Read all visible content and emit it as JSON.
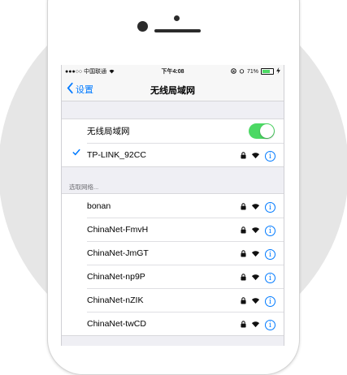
{
  "status_bar": {
    "carrier": "●●●○○ 中国联通",
    "time": "下午4:08",
    "battery": "71%",
    "battery_level": 0.71
  },
  "nav": {
    "back_label": "设置",
    "title": "无线局域网"
  },
  "wifi_toggle": {
    "label": "无线局域网",
    "on": true
  },
  "connected_network": {
    "name": "TP-LINK_92CC"
  },
  "section_header": "选取网络...",
  "networks": [
    {
      "name": "bonan"
    },
    {
      "name": "ChinaNet-FmvH"
    },
    {
      "name": "ChinaNet-JmGT"
    },
    {
      "name": "ChinaNet-np9P"
    },
    {
      "name": "ChinaNet-nZIK"
    },
    {
      "name": "ChinaNet-twCD"
    }
  ],
  "icons": {
    "lock": "lock-icon",
    "wifi": "wifi-icon",
    "info": "info-icon"
  },
  "colors": {
    "accent": "#007aff",
    "toggle_on": "#4cd964",
    "background": "#efeff4"
  }
}
